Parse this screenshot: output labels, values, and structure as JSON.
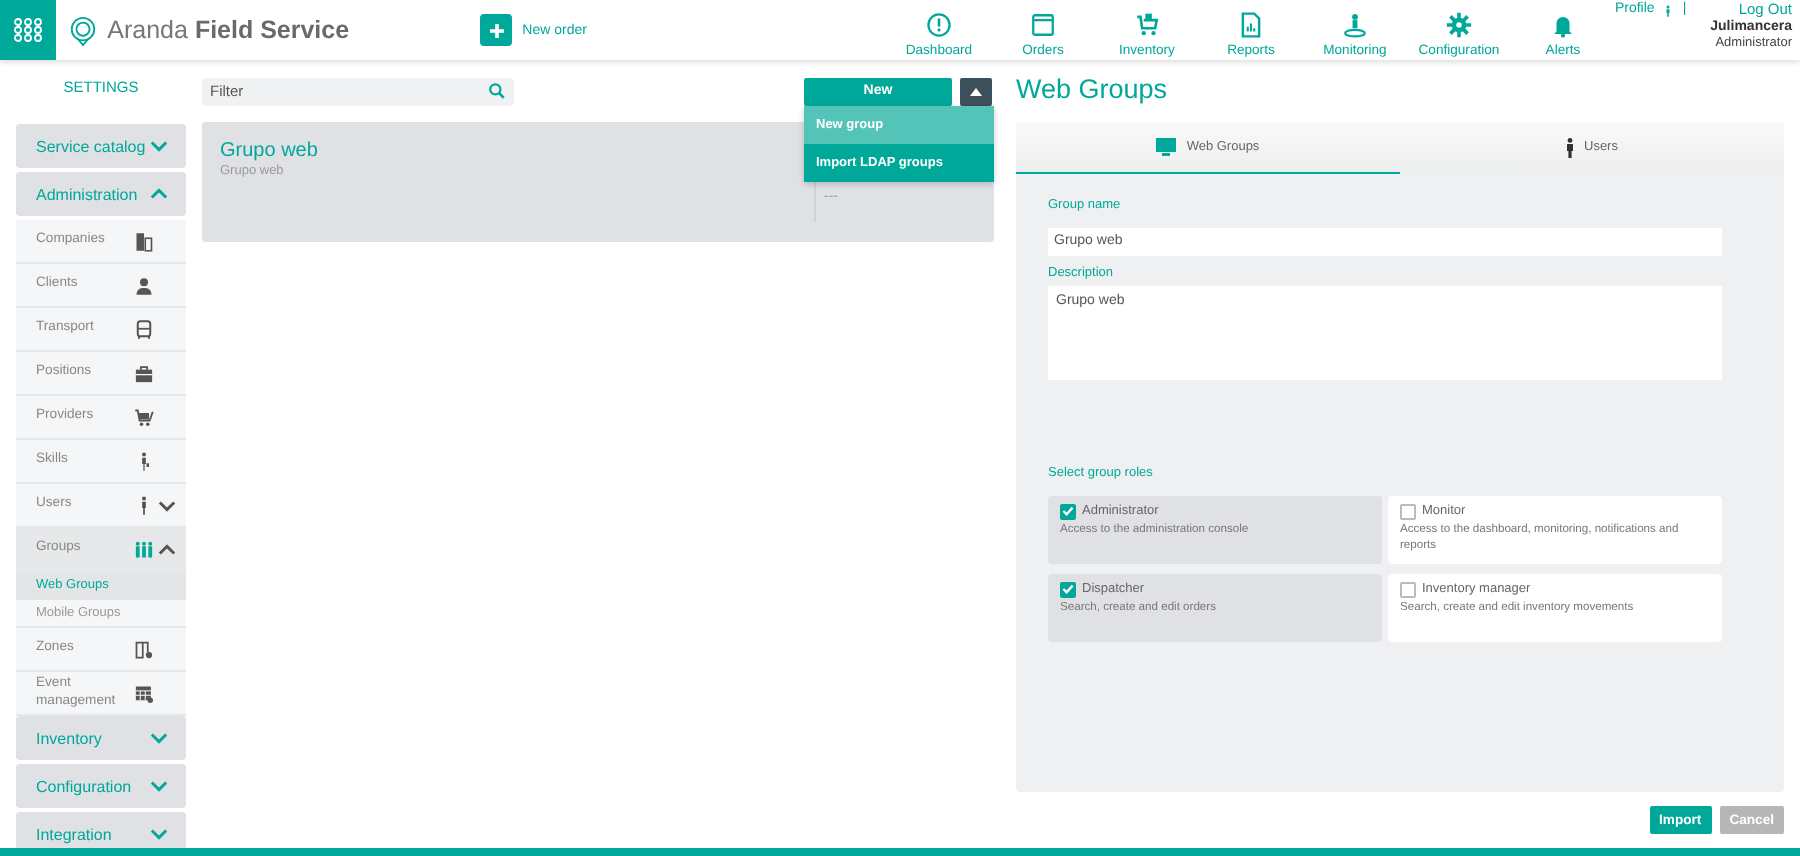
{
  "header": {
    "brand": "Aranda **Field Service**",
    "new_order": "New order",
    "nav": [
      {
        "label": "Dashboard"
      },
      {
        "label": "Orders"
      },
      {
        "label": "Inventory"
      },
      {
        "label": "Reports"
      },
      {
        "label": "Monitoring"
      },
      {
        "label": "Configuration"
      },
      {
        "label": "Alerts"
      }
    ],
    "profile": "Profile",
    "separator": "|",
    "logout": "Log Out",
    "user": "Julimancera",
    "role": "Administrator"
  },
  "sidebar": {
    "title": "SETTINGS",
    "sections": [
      {
        "label": "Service catalog",
        "expanded": false
      },
      {
        "label": "Administration",
        "expanded": true,
        "items": [
          {
            "label": "Companies"
          },
          {
            "label": "Clients"
          },
          {
            "label": "Transport"
          },
          {
            "label": "Positions"
          },
          {
            "label": "Providers"
          },
          {
            "label": "Skills"
          },
          {
            "label": "Users",
            "expanded": false
          },
          {
            "label": "Groups",
            "expanded": true,
            "children": [
              {
                "label": "Web Groups",
                "selected": true
              },
              {
                "label": "Mobile Groups",
                "selected": false
              }
            ]
          },
          {
            "label": "Zones"
          },
          {
            "label": "Event management"
          }
        ]
      },
      {
        "label": "Inventory",
        "expanded": false
      },
      {
        "label": "Configuration",
        "expanded": false
      },
      {
        "label": "Integration",
        "expanded": false
      }
    ]
  },
  "list": {
    "filter_placeholder": "Filter",
    "new_button": "New",
    "menu_open": true,
    "menu": [
      {
        "label": "New group",
        "selected": true
      },
      {
        "label": "Import LDAP groups",
        "selected": false
      }
    ],
    "cards": [
      {
        "title": "Grupo web",
        "subtitle": "Grupo web",
        "extra": "---"
      }
    ]
  },
  "detail": {
    "title": "Web Groups",
    "tabs": [
      {
        "label": "Web Groups",
        "selected": true
      },
      {
        "label": "Users",
        "selected": false
      }
    ],
    "group_name_label": "Group name",
    "group_name": "Grupo web",
    "description_label": "Description",
    "description": "Grupo web",
    "roles_label": "Select group roles",
    "roles": [
      {
        "name": "Administrator",
        "description": "Access to the administration console",
        "checked": true
      },
      {
        "name": "Monitor",
        "description": "Access to the dashboard, monitoring, notifications and reports",
        "checked": false
      },
      {
        "name": "Dispatcher",
        "description": "Search, create and edit orders",
        "checked": true
      },
      {
        "name": "Inventory manager",
        "description": "Search, create and edit inventory movements",
        "checked": false
      }
    ],
    "buttons": [
      {
        "label": "Import",
        "kind": "primary"
      },
      {
        "label": "Cancel",
        "kind": "secondary"
      }
    ]
  }
}
